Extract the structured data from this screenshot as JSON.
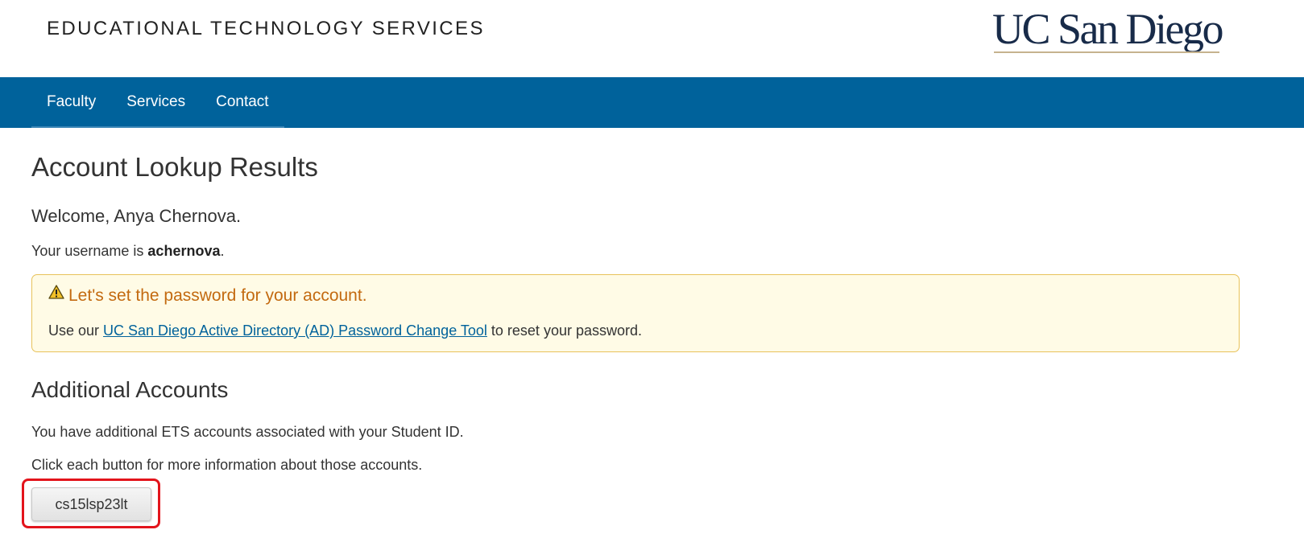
{
  "header": {
    "site_title": "EDUCATIONAL TECHNOLOGY SERVICES",
    "logo_text": "UC San Diego"
  },
  "nav": {
    "items": [
      {
        "label": "Faculty"
      },
      {
        "label": "Services"
      },
      {
        "label": "Contact"
      }
    ]
  },
  "main": {
    "page_title": "Account Lookup Results",
    "welcome": "Welcome, Anya Chernova.",
    "username_prefix": "Your username is ",
    "username": "achernova",
    "username_suffix": ".",
    "alert": {
      "title": "Let's set the password for your account.",
      "body_prefix": "Use our ",
      "link_text": "UC San Diego Active Directory (AD) Password Change Tool",
      "body_suffix": " to reset your password."
    },
    "additional": {
      "title": "Additional Accounts",
      "para1": "You have additional ETS accounts associated with your Student ID.",
      "para2": "Click each button for more information about those accounts.",
      "accounts": [
        {
          "label": "cs15lsp23lt"
        }
      ]
    }
  },
  "colors": {
    "nav_background": "#00629b",
    "logo_navy": "#182b49",
    "logo_gold": "#c6b38e",
    "alert_background": "#fffbe6",
    "alert_border": "#e8c25a",
    "alert_title": "#c36a10",
    "link": "#00629b",
    "highlight": "#e3141c"
  },
  "icons": {
    "alert": "warning-triangle-icon"
  }
}
